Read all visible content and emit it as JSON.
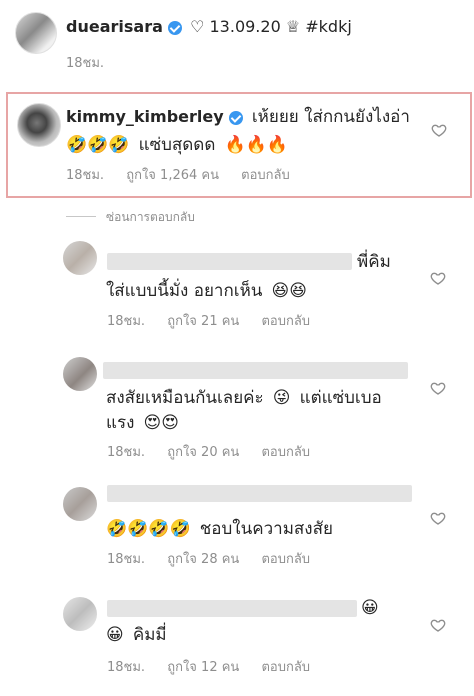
{
  "post": {
    "username": "duearisara",
    "caption": "♡ 13.09.20 ♕ #kdkj",
    "time": "18ชม."
  },
  "highlighted": {
    "username": "kimmy_kimberley",
    "text1": "เห้ยยย ใส่กกนยังไงอ่า",
    "emojis1": "🤣🤣🤣",
    "text2": "แซ่บสุดดด",
    "emojis2": "🔥🔥🔥",
    "time": "18ชม.",
    "likes": "ถูกใจ 1,264 คน",
    "reply": "ตอบกลับ",
    "border_color": "#e7a5a5"
  },
  "hide_replies": "ซ่อนการตอบกลับ",
  "replies": [
    {
      "line1_tail": "พี่คิม",
      "line2": "ใส่แบบนี้มั่ง อยากเห็น",
      "emojis": "😆😆",
      "time": "18ชม.",
      "likes": "ถูกใจ 21 คน",
      "reply": "ตอบกลับ"
    },
    {
      "line1": "สงสัยเหมือนกันเลยค่ะ",
      "emoji_mid": "😜",
      "line1b": "แต่แซ่บเบอ",
      "line2": "แรง",
      "emojis": "😍😍",
      "time": "18ชม.",
      "likes": "ถูกใจ 20 คน",
      "reply": "ตอบกลับ"
    },
    {
      "emojis": "🤣🤣🤣🤣",
      "line2": "ชอบในความสงสัย",
      "time": "18ชม.",
      "likes": "ถูกใจ 28 คน",
      "reply": "ตอบกลับ"
    },
    {
      "emoji_tail": "😀",
      "line2": "คิมมี่",
      "emoji_start": "😀",
      "time": "18ชม.",
      "likes": "ถูกใจ 12 คน",
      "reply": "ตอบกลับ"
    }
  ],
  "colors": {
    "verified": "#3897f0",
    "meta": "#8e8e8e"
  }
}
